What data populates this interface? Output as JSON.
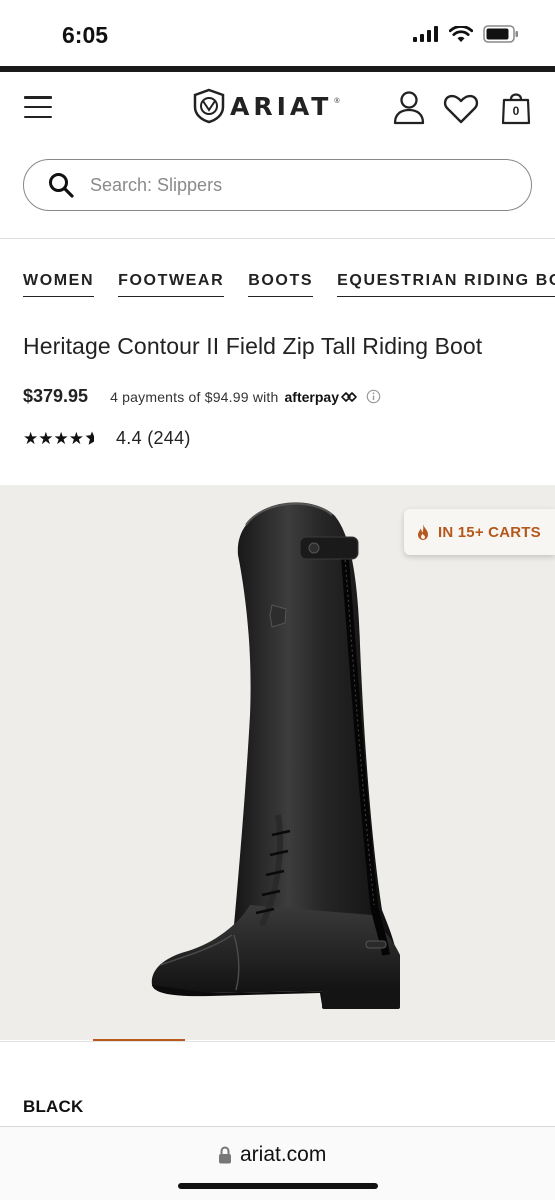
{
  "status_bar": {
    "time": "6:05"
  },
  "header": {
    "brand": "ARIAT",
    "cart_count": "0"
  },
  "search": {
    "placeholder": "Search: Slippers"
  },
  "breadcrumb": [
    "WOMEN",
    "FOOTWEAR",
    "BOOTS",
    "EQUESTRIAN RIDING BOOTS"
  ],
  "product": {
    "title": "Heritage Contour II Field Zip Tall Riding Boot",
    "price": "$379.95",
    "afterpay_text": "4 payments of $94.99 with",
    "afterpay_brand": "afterpay",
    "stars": "★★★★",
    "rating_value": 4.4,
    "rating_text": "4.4 (244)",
    "color_label": "BLACK"
  },
  "gallery": {
    "badge": "IN 15+ CARTS",
    "current_image_index": 1
  },
  "browser": {
    "url": "ariat.com"
  },
  "colors": {
    "accent": "#b85a1e",
    "badge_text": "#b5581c",
    "gallery_bg": "#efede9",
    "boot": "#1b1b1b"
  }
}
